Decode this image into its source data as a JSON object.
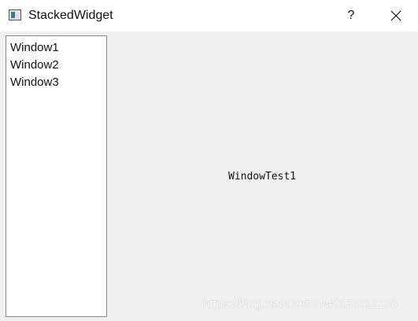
{
  "window": {
    "title": "StackedWidget",
    "help_label": "?",
    "icons": {
      "app": "app-window-icon",
      "close": "close-icon"
    }
  },
  "list": {
    "items": [
      "Window1",
      "Window2",
      "Window3"
    ]
  },
  "stack": {
    "current_label": "WindowTest1"
  },
  "watermark": "https://blog.csdn.net/SNAKEpc12138"
}
